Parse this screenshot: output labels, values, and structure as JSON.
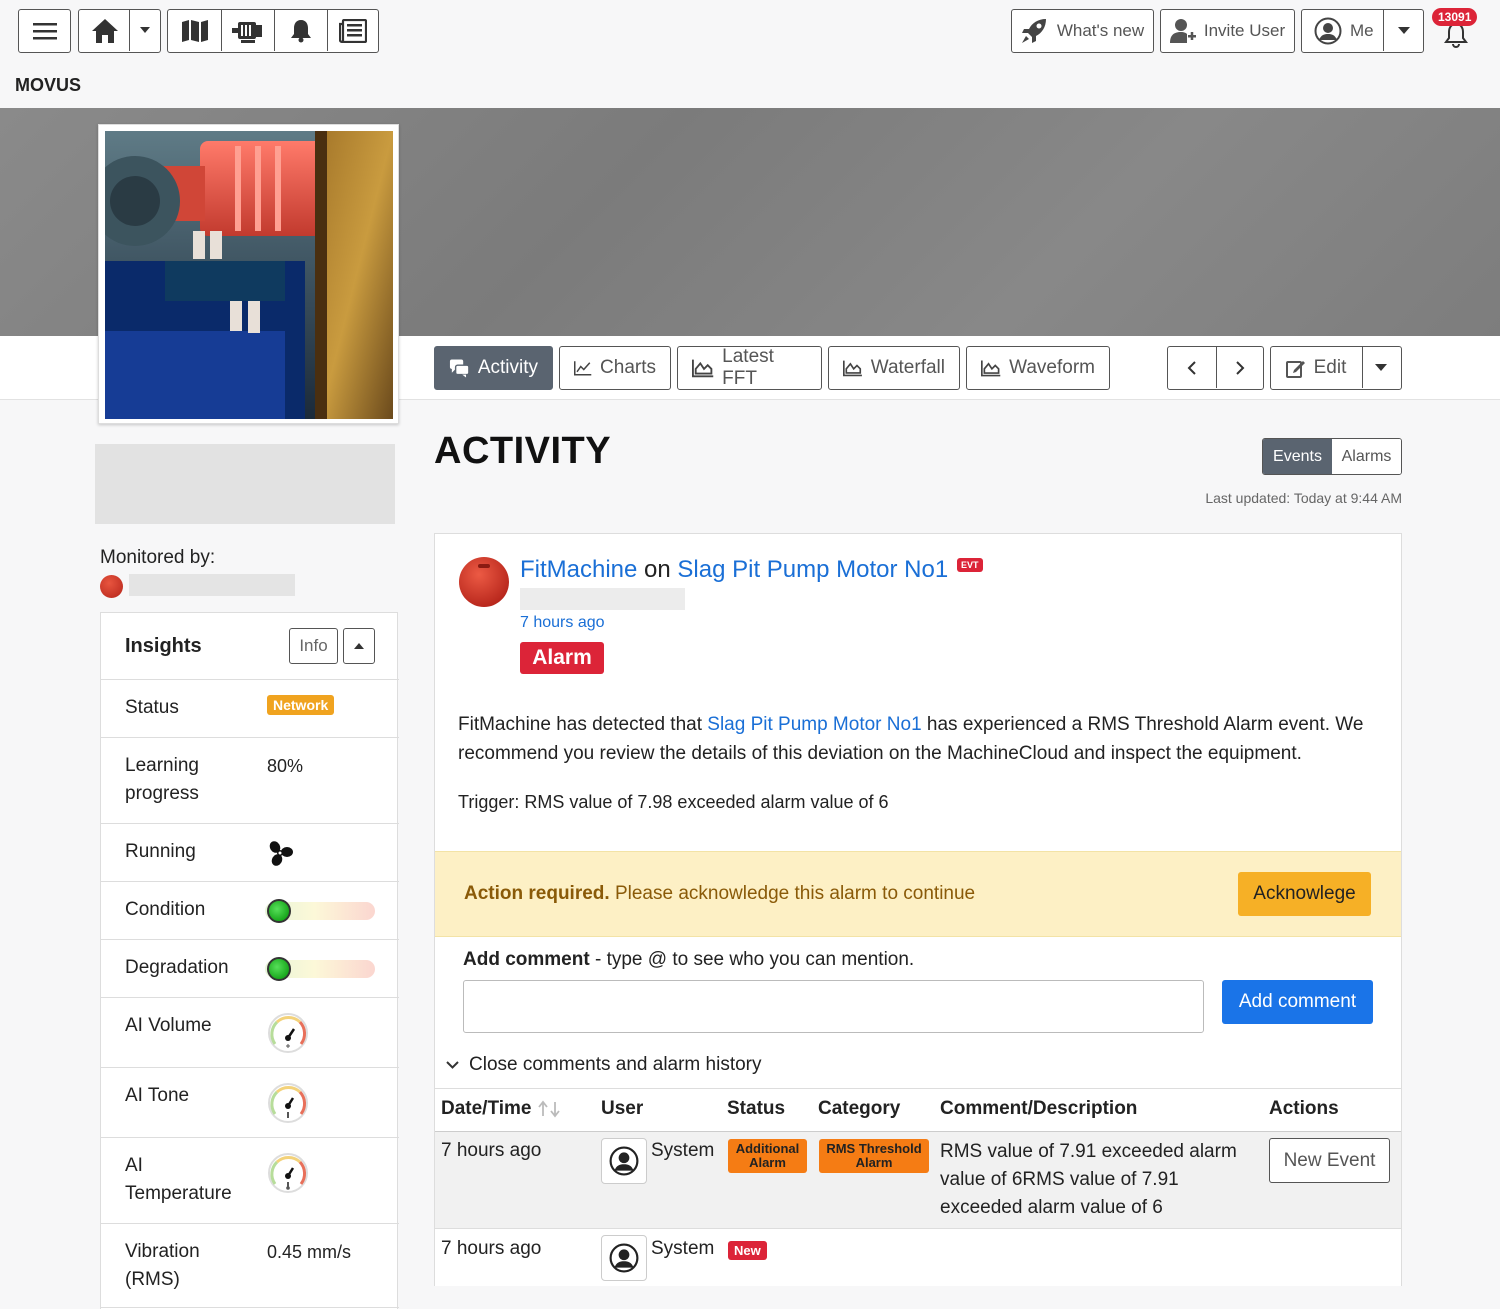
{
  "topbar": {
    "brand": "MOVUS",
    "whats_new": "What's new",
    "invite_user": "Invite User",
    "me": "Me",
    "notification_count": "13091"
  },
  "tabs": [
    {
      "label": "Activity",
      "icon": "comments-icon",
      "active": true
    },
    {
      "label": "Charts",
      "icon": "line-chart-icon"
    },
    {
      "label": "Latest FFT",
      "icon": "area-chart-icon"
    },
    {
      "label": "Waterfall",
      "icon": "area-chart-icon"
    },
    {
      "label": "Waveform",
      "icon": "area-chart-icon"
    }
  ],
  "edit_label": "Edit",
  "sidebar": {
    "monitored_by_label": "Monitored by:",
    "insights": {
      "title": "Insights",
      "info_label": "Info",
      "rows": {
        "status": {
          "label": "Status",
          "value": "Network"
        },
        "learning": {
          "label": "Learning progress",
          "value": "80%"
        },
        "running": {
          "label": "Running"
        },
        "condition": {
          "label": "Condition",
          "level": 0.05
        },
        "degradation": {
          "label": "Degradation",
          "level": 0.05
        },
        "ai_volume": {
          "label": "AI Volume"
        },
        "ai_tone": {
          "label": "AI Tone"
        },
        "ai_temperature": {
          "label": "AI Temperature"
        },
        "vibration": {
          "label": "Vibration (RMS)",
          "value": "0.45 mm/s"
        }
      }
    }
  },
  "main": {
    "title": "ACTIVITY",
    "toggle": {
      "events": "Events",
      "alarms": "Alarms"
    },
    "last_updated": "Last updated: Today at 9:44 AM",
    "event": {
      "source": "FitMachine",
      "on": "on",
      "machine": "Slag Pit Pump Motor No1",
      "tag": "EVT",
      "time": "7 hours ago",
      "type": "Alarm",
      "body_prefix": "FitMachine has detected that ",
      "body_link": "Slag Pit Pump Motor No1",
      "body_suffix": " has experienced a RMS Threshold Alarm event. We recommend you review the details of this deviation on the MachineCloud and inspect the equipment.",
      "trigger": "Trigger: RMS value of 7.98 exceeded alarm value of 6"
    },
    "action_required": {
      "bold": "Action required.",
      "text": " Please acknowledge this alarm to continue",
      "button": "Acknowlege"
    },
    "comment": {
      "label_bold": "Add comment",
      "label_rest": " - type @ to see who you can mention.",
      "placeholder": "",
      "button": "Add comment",
      "toggle": "Close comments and alarm history"
    },
    "history": {
      "headers": [
        "Date/Time",
        "User",
        "Status",
        "Category",
        "Comment/Description",
        "Actions"
      ],
      "rows": [
        {
          "time": "7 hours ago",
          "user": "System",
          "status": "Additional Alarm",
          "category": "RMS Threshold Alarm",
          "description": "RMS value of 7.91 exceeded alarm value of 6RMS value of 7.91 exceeded alarm value of 6",
          "action": "New Event"
        },
        {
          "time": "7 hours ago",
          "user": "System",
          "status": "New"
        }
      ]
    }
  },
  "colors": {
    "accent": "#1a6fd6",
    "alarm": "#dc2438",
    "warning": "#f6b026",
    "orange": "#f57c14",
    "network_badge": "#f0a31f"
  }
}
